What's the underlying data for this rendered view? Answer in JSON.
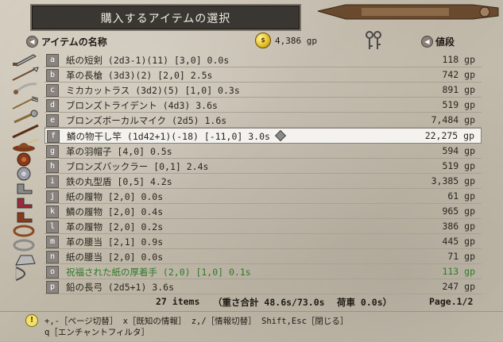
{
  "title": "購入するアイテムの選択",
  "header": {
    "name_label": "アイテムの名称",
    "gold": "4,386 gp",
    "price_label": "値段"
  },
  "items": [
    {
      "key": "a",
      "name": "紙の短剣 (2d3-1)(11) [3,0] 0.0s",
      "price": "118 gp",
      "icon": "dagger-icon"
    },
    {
      "key": "b",
      "name": "革の長槍 (3d3)(2) [2,0] 2.5s",
      "price": "742 gp",
      "icon": "spear-icon"
    },
    {
      "key": "c",
      "name": "ミカカットラス (3d2)(5) [1,0] 0.3s",
      "price": "891 gp",
      "icon": "cutlass-icon"
    },
    {
      "key": "d",
      "name": "ブロンズトライデント (4d3) 3.6s",
      "price": "519 gp",
      "icon": "trident-icon"
    },
    {
      "key": "e",
      "name": "ブロンズボーカルマイク (2d5) 1.6s",
      "price": "7,484 gp",
      "icon": "mic-icon"
    },
    {
      "key": "f",
      "name": "鱗の物干し竿 (1d42+1)(-18) [-11,0] 3.0s",
      "price": "22,275 gp",
      "icon": "pole-icon",
      "selected": true
    },
    {
      "key": "g",
      "name": "革の羽帽子 [4,0] 0.5s",
      "price": "594 gp",
      "icon": "hat-icon"
    },
    {
      "key": "h",
      "name": "ブロンズバックラー [0,1] 2.4s",
      "price": "519 gp",
      "icon": "buckler-icon"
    },
    {
      "key": "i",
      "name": "鉄の丸型盾 [0,5] 4.2s",
      "price": "3,385 gp",
      "icon": "round-shield-icon"
    },
    {
      "key": "j",
      "name": "紙の履物 [2,0] 0.0s",
      "price": "61 gp",
      "icon": "footwear-icon"
    },
    {
      "key": "k",
      "name": "鱗の履物 [2,0] 0.4s",
      "price": "965 gp",
      "icon": "footwear-icon"
    },
    {
      "key": "l",
      "name": "革の履物 [2,0] 0.2s",
      "price": "386 gp",
      "icon": "footwear-icon"
    },
    {
      "key": "m",
      "name": "革の腰当 [2,1] 0.9s",
      "price": "445 gp",
      "icon": "belt-icon"
    },
    {
      "key": "n",
      "name": "紙の腰当 [2,0] 0.0s",
      "price": "71 gp",
      "icon": "belt-icon"
    },
    {
      "key": "o",
      "name": "祝福された紙の厚着手 (2,0) [1,0] 0.1s",
      "price": "113 gp",
      "icon": "gauntlet-icon",
      "green": true
    },
    {
      "key": "p",
      "name": "鉛の長弓 (2d5+1) 3.6s",
      "price": "247 gp",
      "icon": "longbow-icon"
    }
  ],
  "footer": {
    "count": "27 items",
    "weight": "（重さ合計 48.6s/73.0s",
    "cargo": "荷車 0.0s）",
    "page": "Page.1/2"
  },
  "help": {
    "line1": "+,-［ページ切替］ x［既知の情報］ z,/［情報切替］ Shift,Esc［閉じる］",
    "line2": "q［エンチャントフィルタ］"
  },
  "colors": {
    "title_bg": "#3a3632",
    "selected_bg": "#f4f2ee",
    "green_text": "#2f7a2a",
    "parchment": "#c6bfae"
  }
}
